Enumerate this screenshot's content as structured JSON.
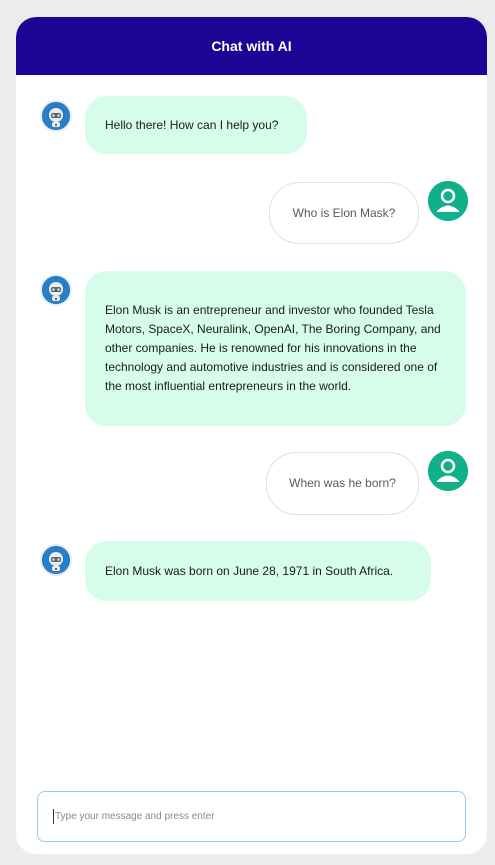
{
  "header": {
    "title": "Chat with AI"
  },
  "messages": [
    {
      "role": "bot",
      "text": "Hello there! How can I help you?"
    },
    {
      "role": "user",
      "text": "Who is Elon Mask?"
    },
    {
      "role": "bot",
      "text": "Elon Musk is an entrepreneur and investor who founded Tesla Motors, SpaceX, Neuralink, OpenAI, The Boring Company, and other companies. He is renowned for his innovations in the technology and automotive industries and is considered one of the most influential entrepreneurs in the world."
    },
    {
      "role": "user",
      "text": "When was he born?"
    },
    {
      "role": "bot",
      "text": "Elon Musk was born on June 28, 1971 in South Africa."
    }
  ],
  "composer": {
    "placeholder": "Type your message and press enter",
    "value": ""
  },
  "colors": {
    "header_bg": "#1c0594",
    "bot_bubble": "#d5fde9",
    "user_avatar": "#0fb08a",
    "bot_avatar": "#1e6fb8"
  },
  "icons": {
    "bot": "robot-icon",
    "user": "user-icon"
  }
}
